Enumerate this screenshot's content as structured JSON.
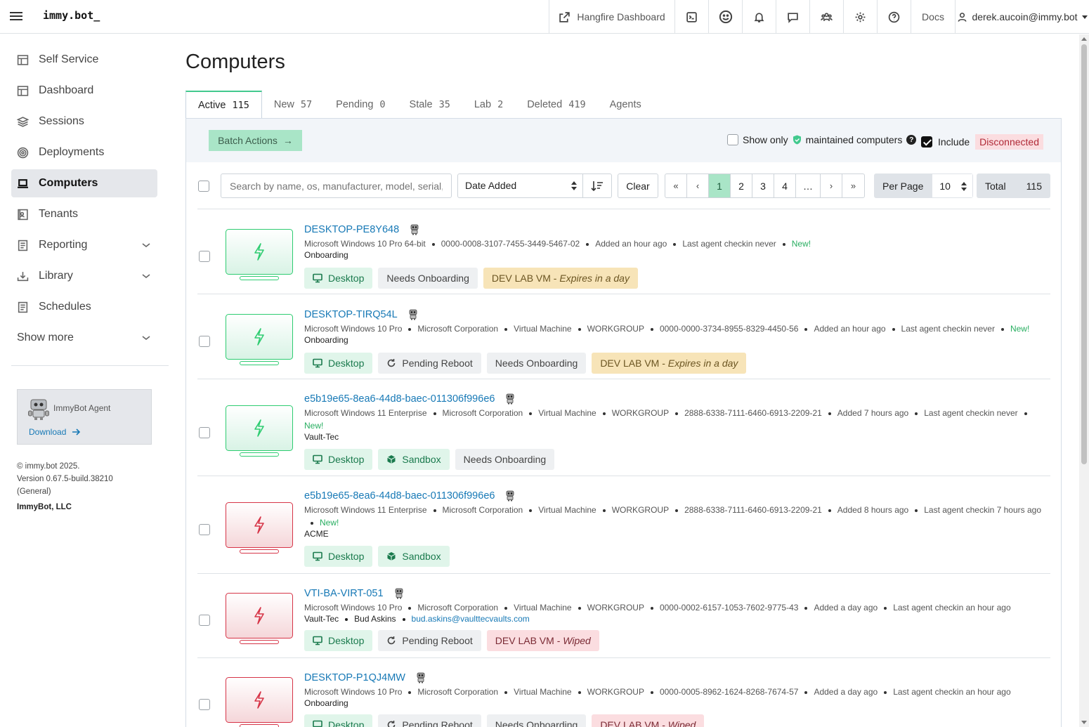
{
  "app": {
    "logo": "immy.bot_"
  },
  "topbar": {
    "hangfire": "Hangfire Dashboard",
    "docs": "Docs",
    "user": "derek.aucoin@immy.bot"
  },
  "sidebar": {
    "items": [
      {
        "label": "Self Service"
      },
      {
        "label": "Dashboard"
      },
      {
        "label": "Sessions"
      },
      {
        "label": "Deployments"
      },
      {
        "label": "Computers"
      },
      {
        "label": "Tenants"
      },
      {
        "label": "Reporting"
      },
      {
        "label": "Library"
      },
      {
        "label": "Schedules"
      },
      {
        "label": "Show more"
      }
    ],
    "agent": {
      "name": "ImmyBot Agent",
      "download": "Download"
    },
    "footer": {
      "copyright": "© immy.bot 2025.",
      "version": "Version 0.67.5-build.38210",
      "channel": "(General)",
      "company": "ImmyBot, LLC"
    }
  },
  "page": {
    "title": "Computers"
  },
  "tabs": [
    {
      "label": "Active",
      "count": "115"
    },
    {
      "label": "New",
      "count": "57"
    },
    {
      "label": "Pending",
      "count": "0"
    },
    {
      "label": "Stale",
      "count": "35"
    },
    {
      "label": "Lab",
      "count": "2"
    },
    {
      "label": "Deleted",
      "count": "419"
    },
    {
      "label": "Agents",
      "count": ""
    }
  ],
  "actions": {
    "batch": "Batch Actions",
    "show_only_pre": "Show only",
    "show_only_post": "maintained computers",
    "include": "Include",
    "disconnected": "Disconnected"
  },
  "filters": {
    "search_placeholder": "Search by name, os, manufacturer, model, serial, domain",
    "sort_by": "Date Added",
    "clear": "Clear",
    "pages": [
      "«",
      "‹",
      "1",
      "2",
      "3",
      "4",
      "…",
      "›",
      "»"
    ],
    "per_page_label": "Per Page",
    "per_page_value": "10",
    "total_label": "Total",
    "total_value": "115"
  },
  "computers": [
    {
      "name": "DESKTOP-PE8Y648",
      "status": "connected",
      "meta": [
        "Microsoft Windows 10 Pro 64-bit",
        "0000-0008-3107-7455-3449-5467-02",
        "Added an hour ago",
        "Last agent checkin never"
      ],
      "new": "New!",
      "sub": [
        "Onboarding"
      ],
      "badges": [
        {
          "label": "Desktop",
          "type": "green",
          "icon": "monitor-icon"
        },
        {
          "label": "Needs Onboarding",
          "type": "gray"
        },
        {
          "label": "DEV LAB VM - ",
          "em": "Expires in a day",
          "type": "yellow"
        }
      ]
    },
    {
      "name": "DESKTOP-TIRQ54L",
      "status": "connected",
      "meta": [
        "Microsoft Windows 10 Pro",
        "Microsoft Corporation",
        "Virtual Machine",
        "WORKGROUP",
        "0000-0000-3734-8955-8329-4450-56",
        "Added an hour ago",
        "Last agent checkin never"
      ],
      "new": "New!",
      "sub": [
        "Onboarding"
      ],
      "badges": [
        {
          "label": "Desktop",
          "type": "green",
          "icon": "monitor-icon"
        },
        {
          "label": "Pending Reboot",
          "type": "gray",
          "icon": "reboot-icon"
        },
        {
          "label": "Needs Onboarding",
          "type": "gray"
        },
        {
          "label": "DEV LAB VM - ",
          "em": "Expires in a day",
          "type": "yellow"
        }
      ]
    },
    {
      "name": "e5b19e65-8ea6-44d8-baec-011306f996e6",
      "status": "connected",
      "meta": [
        "Microsoft Windows 11 Enterprise",
        "Microsoft Corporation",
        "Virtual Machine",
        "WORKGROUP",
        "2888-6338-7111-6460-6913-2209-21",
        "Added 7 hours ago",
        "Last agent checkin never"
      ],
      "new": "New!",
      "sub": [
        "Vault-Tec"
      ],
      "badges": [
        {
          "label": "Desktop",
          "type": "green",
          "icon": "monitor-icon"
        },
        {
          "label": "Sandbox",
          "type": "green",
          "icon": "box-icon"
        },
        {
          "label": "Needs Onboarding",
          "type": "gray"
        }
      ]
    },
    {
      "name": "e5b19e65-8ea6-44d8-baec-011306f996e6",
      "status": "disconnected",
      "meta": [
        "Microsoft Windows 11 Enterprise",
        "Microsoft Corporation",
        "Virtual Machine",
        "WORKGROUP",
        "2888-6338-7111-6460-6913-2209-21",
        "Added 8 hours ago",
        "Last agent checkin 7 hours ago"
      ],
      "new": "New!",
      "sub": [
        "ACME"
      ],
      "badges": [
        {
          "label": "Desktop",
          "type": "green",
          "icon": "monitor-icon"
        },
        {
          "label": "Sandbox",
          "type": "green",
          "icon": "box-icon"
        }
      ]
    },
    {
      "name": "VTI-BA-VIRT-051",
      "status": "disconnected",
      "meta": [
        "Microsoft Windows 10 Pro",
        "Microsoft Corporation",
        "Virtual Machine",
        "WORKGROUP",
        "0000-0002-6157-1053-7602-9775-43",
        "Added a day ago",
        "Last agent checkin an hour ago"
      ],
      "new": "",
      "sub": [
        "Vault-Tec",
        "Bud Askins",
        "bud.askins@vaulttecvaults.com"
      ],
      "badges": [
        {
          "label": "Desktop",
          "type": "green",
          "icon": "monitor-icon"
        },
        {
          "label": "Pending Reboot",
          "type": "gray",
          "icon": "reboot-icon"
        },
        {
          "label": "DEV LAB VM - ",
          "em": "Wiped",
          "type": "red"
        }
      ]
    },
    {
      "name": "DESKTOP-P1QJ4MW",
      "status": "disconnected",
      "meta": [
        "Microsoft Windows 10 Pro",
        "Microsoft Corporation",
        "Virtual Machine",
        "WORKGROUP",
        "0000-0005-8962-1624-8268-7674-57",
        "Added a day ago",
        "Last agent checkin an hour ago"
      ],
      "new": "",
      "sub": [
        "Onboarding"
      ],
      "badges": [
        {
          "label": "Desktop",
          "type": "green",
          "icon": "monitor-icon"
        },
        {
          "label": "Pending Reboot",
          "type": "gray",
          "icon": "reboot-icon"
        },
        {
          "label": "Needs Onboarding",
          "type": "gray"
        },
        {
          "label": "DEV LAB VM - ",
          "em": "Wiped",
          "type": "red"
        }
      ]
    }
  ],
  "colors": {
    "accent": "#a9e5c7",
    "link": "#1779b6",
    "new": "#27ae60",
    "connected": "#2ecc71",
    "disconnected": "#d63447"
  }
}
